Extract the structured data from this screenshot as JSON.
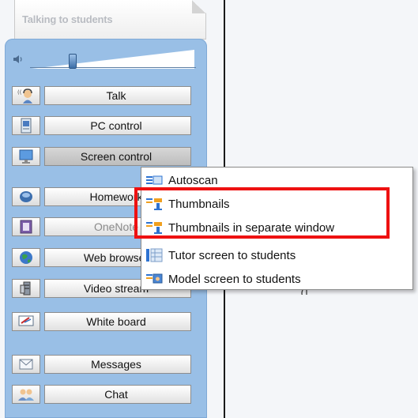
{
  "panel": {
    "title": "Talking to students"
  },
  "toolbar": {
    "buttons": [
      {
        "label": "Talk",
        "icon": "talk-headset-icon"
      },
      {
        "label": "PC control",
        "icon": "pc-control-icon"
      },
      {
        "label": "Screen control",
        "icon": "screen-control-icon",
        "state": "active"
      },
      {
        "label": "Homework",
        "icon": "homework-icon"
      },
      {
        "label": "OneNote",
        "icon": "onenote-icon",
        "state": "disabled"
      },
      {
        "label": "Web browser",
        "icon": "globe-icon"
      },
      {
        "label": "Video stream",
        "icon": "video-stream-icon"
      },
      {
        "label": "White board",
        "icon": "whiteboard-icon"
      },
      {
        "label": "Messages",
        "icon": "envelope-icon"
      },
      {
        "label": "Chat",
        "icon": "chat-users-icon"
      }
    ]
  },
  "context_menu": {
    "items": [
      {
        "label": "Autoscan",
        "icon": "autoscan-icon"
      },
      {
        "label": "Thumbnails",
        "icon": "thumbnails-icon"
      },
      {
        "label": "Thumbnails in separate window",
        "icon": "thumbnails-window-icon"
      },
      {
        "label": "Tutor screen to students",
        "icon": "tutor-screen-icon"
      },
      {
        "label": "Model screen to students",
        "icon": "model-screen-icon"
      }
    ]
  },
  "colors": {
    "sidebar": "#99bfe6",
    "highlight": "#ee1111",
    "menu_bg": "#ffffff"
  }
}
